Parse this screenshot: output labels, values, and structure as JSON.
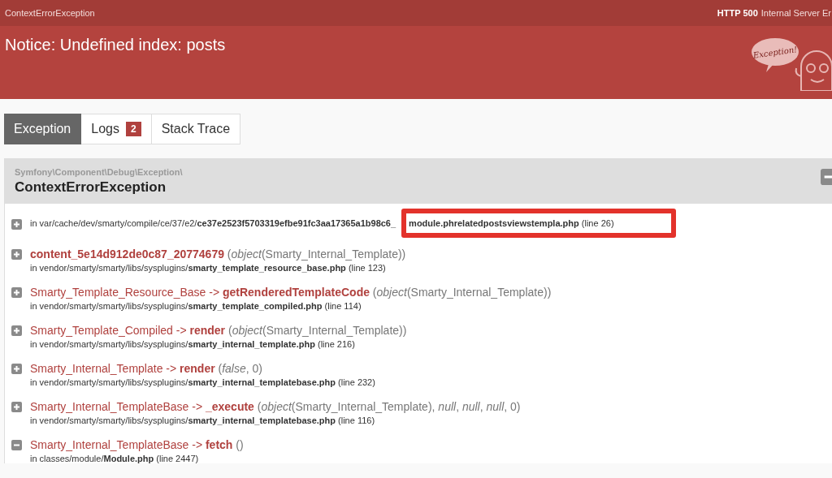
{
  "top_bar": {
    "exception_class": "ContextErrorException",
    "status_code": "HTTP 500",
    "status_text": "Internal Server Er"
  },
  "header": {
    "title": "Notice: Undefined index: posts",
    "mascot_text": "Exception!"
  },
  "tabs": [
    {
      "label": "Exception",
      "selected": true
    },
    {
      "label": "Logs",
      "selected": false,
      "badge": "2"
    },
    {
      "label": "Stack Trace",
      "selected": false
    }
  ],
  "panel": {
    "namespace": "Symfony\\Component\\Debug\\Exception\\",
    "class": "ContextErrorException",
    "expanded": true
  },
  "trace": [
    {
      "kind": "file",
      "expanded": false,
      "file": "in var/cache/dev/smarty/compile/ce/37/e2/**ce37e2523f5703319efbe91fc3aa17365a1b98c6_**",
      "highlight": "**module.phrelatedpostsviewstempla.php** (line 26)"
    },
    {
      "kind": "call",
      "expanded": false,
      "method": "content_5e14d912de0c87_20774679",
      "args": "(*object*(Smarty_Internal_Template))",
      "file": "in vendor/smarty/smarty/libs/sysplugins/**smarty_template_resource_base.php** (line 123)"
    },
    {
      "kind": "call",
      "expanded": false,
      "class": "Smarty_Template_Resource_Base",
      "arrow": "->",
      "method": "getRenderedTemplateCode",
      "args": "(*object*(Smarty_Internal_Template))",
      "file": "in vendor/smarty/smarty/libs/sysplugins/**smarty_template_compiled.php** (line 114)"
    },
    {
      "kind": "call",
      "expanded": false,
      "class": "Smarty_Template_Compiled",
      "arrow": "->",
      "method": "render",
      "args": "(*object*(Smarty_Internal_Template))",
      "file": "in vendor/smarty/smarty/libs/sysplugins/**smarty_internal_template.php** (line 216)"
    },
    {
      "kind": "call",
      "expanded": false,
      "class": "Smarty_Internal_Template",
      "arrow": "->",
      "method": "render",
      "args": "(*false*, 0)",
      "file": "in vendor/smarty/smarty/libs/sysplugins/**smarty_internal_templatebase.php** (line 232)"
    },
    {
      "kind": "call",
      "expanded": false,
      "class": "Smarty_Internal_TemplateBase",
      "arrow": "->",
      "method": "_execute",
      "args": "(*object*(Smarty_Internal_Template), *null*, *null*, *null*, 0)",
      "file": "in vendor/smarty/smarty/libs/sysplugins/**smarty_internal_templatebase.php** (line 116)"
    },
    {
      "kind": "call",
      "expanded": true,
      "class": "Smarty_Internal_TemplateBase",
      "arrow": "->",
      "method": "fetch",
      "args": "()",
      "file": "in classes/module/**Module.php** (line 2447)"
    }
  ]
}
